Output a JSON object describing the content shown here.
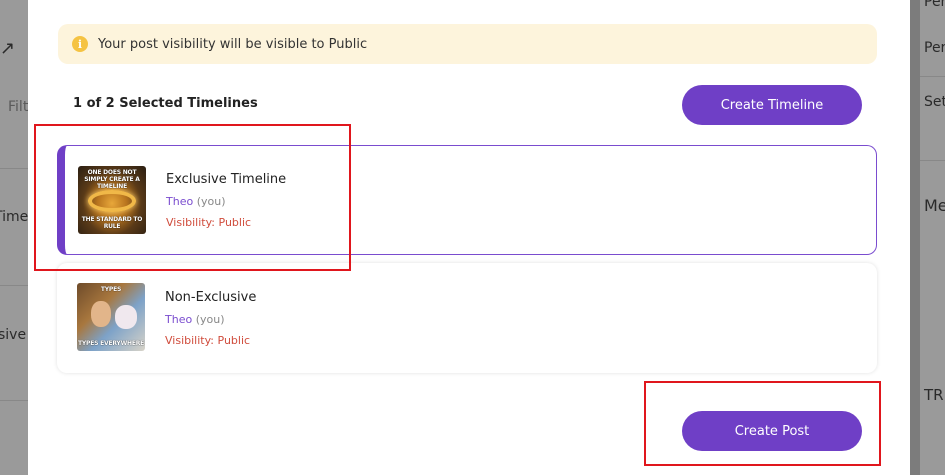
{
  "background": {
    "left_fragments": [
      "Filt",
      "Timel",
      "sive"
    ],
    "right_fragments": [
      "Peri",
      "Setti",
      "Medi",
      "TRIA"
    ]
  },
  "notice": {
    "icon": "info-icon",
    "text": "Your post visibility will be visible to Public"
  },
  "selection": {
    "count_label": "1 of 2 Selected Timelines"
  },
  "buttons": {
    "create_timeline": "Create Timeline",
    "create_post": "Create Post"
  },
  "timelines": [
    {
      "title": "Exclusive Timeline",
      "owner": "Theo",
      "owner_suffix": "(you)",
      "visibility": "Visibility: Public",
      "selected": true,
      "thumb_caption_top": "ONE DOES NOT SIMPLY CREATE A TIMELINE",
      "thumb_caption_bottom": "THE STANDARD TO RULE"
    },
    {
      "title": "Non-Exclusive",
      "owner": "Theo",
      "owner_suffix": "(you)",
      "visibility": "Visibility: Public",
      "selected": false,
      "thumb_caption_top": "TYPES",
      "thumb_caption_bottom": "TYPES EVERYWHERE"
    }
  ],
  "colors": {
    "accent": "#6f3fc6",
    "notice_bg": "#fdf4dc",
    "visibility_text": "#d04c3c",
    "highlight": "#e0161d"
  }
}
